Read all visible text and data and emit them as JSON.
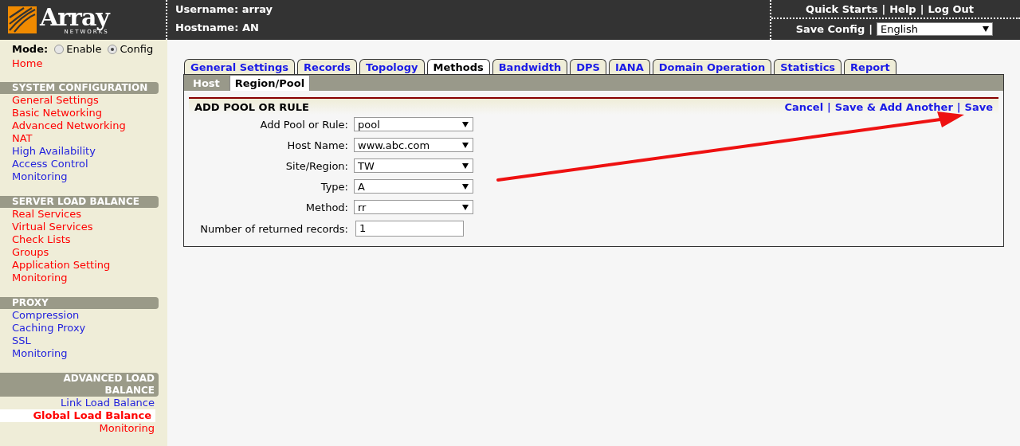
{
  "header": {
    "logo": {
      "name": "Array",
      "tagline": "NETWORKS"
    },
    "username": "Username: array",
    "hostname": "Hostname: AN",
    "separator": "|",
    "links": [
      "Quick Starts",
      "Help",
      "Log Out"
    ],
    "save_config": "Save Config",
    "language": "English"
  },
  "sidebar": {
    "mode_label": "Mode:",
    "modes": [
      {
        "label": "Enable",
        "selected": false
      },
      {
        "label": "Config",
        "selected": true
      }
    ],
    "home": "Home",
    "sections": [
      {
        "title": "SYSTEM CONFIGURATION",
        "kind": "left",
        "items": [
          {
            "label": "General Settings",
            "color": "#ff0000",
            "selected": false
          },
          {
            "label": "Basic Networking",
            "color": "#ff0000",
            "selected": false
          },
          {
            "label": "Advanced Networking",
            "color": "#ff0000",
            "selected": false
          },
          {
            "label": "NAT",
            "color": "#ff0000",
            "selected": false
          },
          {
            "label": "High Availability",
            "color": "#2222dd",
            "selected": false
          },
          {
            "label": "Access Control",
            "color": "#2222dd",
            "selected": false
          },
          {
            "label": "Monitoring",
            "color": "#2222dd",
            "selected": false
          }
        ]
      },
      {
        "title": "SERVER LOAD BALANCE",
        "kind": "left",
        "items": [
          {
            "label": "Real Services",
            "color": "#ff0000",
            "selected": false
          },
          {
            "label": "Virtual Services",
            "color": "#ff0000",
            "selected": false
          },
          {
            "label": "Check Lists",
            "color": "#ff0000",
            "selected": false
          },
          {
            "label": "Groups",
            "color": "#ff0000",
            "selected": false
          },
          {
            "label": "Application Setting",
            "color": "#ff0000",
            "selected": false
          },
          {
            "label": "Monitoring",
            "color": "#ff0000",
            "selected": false
          }
        ]
      },
      {
        "title": "PROXY",
        "kind": "left",
        "items": [
          {
            "label": "Compression",
            "color": "#2222dd",
            "selected": false
          },
          {
            "label": "Caching Proxy",
            "color": "#2222dd",
            "selected": false
          },
          {
            "label": "SSL",
            "color": "#2222dd",
            "selected": false
          },
          {
            "label": "Monitoring",
            "color": "#2222dd",
            "selected": false
          }
        ]
      },
      {
        "title": "ADVANCED LOAD BALANCE",
        "kind": "right",
        "items": [
          {
            "label": "Link Load Balance",
            "color": "#2222dd",
            "selected": false
          },
          {
            "label": "Global Load Balance",
            "color": "#ff0000",
            "selected": true
          },
          {
            "label": "Monitoring",
            "color": "#ff0000",
            "selected": false
          }
        ]
      }
    ]
  },
  "tabs": [
    {
      "label": "General Settings",
      "selected": false
    },
    {
      "label": "Records",
      "selected": false
    },
    {
      "label": "Topology",
      "selected": false
    },
    {
      "label": "Methods",
      "selected": true
    },
    {
      "label": "Bandwidth",
      "selected": false
    },
    {
      "label": "DPS",
      "selected": false
    },
    {
      "label": "IANA",
      "selected": false
    },
    {
      "label": "Domain Operation",
      "selected": false
    },
    {
      "label": "Statistics",
      "selected": false
    },
    {
      "label": "Report",
      "selected": false
    }
  ],
  "subtabs": [
    {
      "label": "Host",
      "selected": false
    },
    {
      "label": "Region/Pool",
      "selected": true
    }
  ],
  "form": {
    "title": "ADD POOL OR RULE",
    "actions": [
      "Cancel",
      "Save & Add Another",
      "Save"
    ],
    "separator": "|",
    "fields": [
      {
        "label": "Add Pool or Rule:",
        "kind": "select",
        "value": "pool"
      },
      {
        "label": "Host Name:",
        "kind": "select",
        "value": "www.abc.com"
      },
      {
        "label": "Site/Region:",
        "kind": "select",
        "value": "TW"
      },
      {
        "label": "Type:",
        "kind": "select",
        "value": "A"
      },
      {
        "label": "Method:",
        "kind": "select",
        "value": "rr"
      },
      {
        "label": "Number of returned records:",
        "kind": "text",
        "value": "1"
      }
    ]
  }
}
